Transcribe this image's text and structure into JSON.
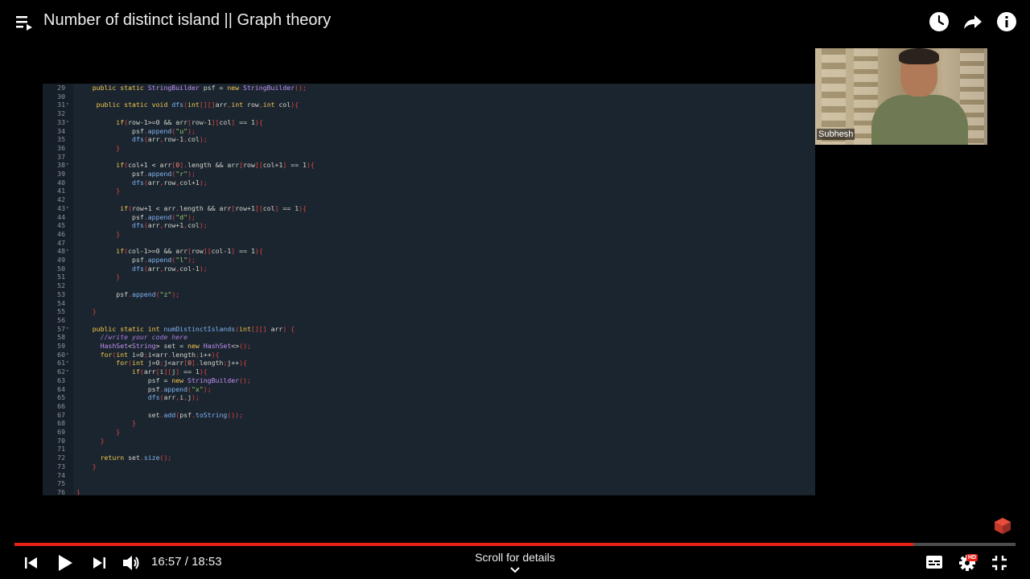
{
  "video": {
    "title": "Number of distinct island || Graph theory",
    "presenter_name": "Subhesh",
    "current_time": "16:57",
    "separator": " / ",
    "duration": "18:53",
    "progress_fraction": 0.898,
    "scroll_hint": "Scroll for details",
    "hd_badge": "HD"
  },
  "icons": {
    "playlist": "playlist-icon",
    "watch_later": "clock-icon",
    "share": "share-icon",
    "info": "info-icon",
    "prev": "previous-icon",
    "play": "play-icon",
    "next": "next-icon",
    "volume": "volume-icon",
    "captions": "captions-icon",
    "settings": "gear-icon",
    "fullscreen_exit": "exit-fullscreen-icon"
  },
  "colors": {
    "progress": "#e62117",
    "editor_bg": "#1b2530"
  },
  "code_lines": [
    {
      "n": "29",
      "fold": false,
      "parts": [
        [
          "",
          "    "
        ],
        [
          "kw",
          "public static "
        ],
        [
          "ty",
          "StringBuilder "
        ],
        [
          "",
          "psf = "
        ],
        [
          "kw",
          "new "
        ],
        [
          "ty",
          "StringBuilder"
        ],
        [
          "pn",
          "();"
        ]
      ]
    },
    {
      "n": "30",
      "fold": false,
      "parts": []
    },
    {
      "n": "31",
      "fold": true,
      "parts": [
        [
          "",
          "     "
        ],
        [
          "kw",
          "public static void "
        ],
        [
          "fn",
          "dfs"
        ],
        [
          "pn",
          "("
        ],
        [
          "kw",
          "int"
        ],
        [
          "pn",
          "[][]"
        ],
        [
          "",
          "arr"
        ],
        [
          "pn",
          ","
        ],
        [
          "kw",
          "int "
        ],
        [
          "",
          "row"
        ],
        [
          "pn",
          ","
        ],
        [
          "kw",
          "int "
        ],
        [
          "",
          "col"
        ],
        [
          "pn",
          "){"
        ]
      ]
    },
    {
      "n": "32",
      "fold": false,
      "parts": []
    },
    {
      "n": "33",
      "fold": true,
      "parts": [
        [
          "",
          "          "
        ],
        [
          "kw",
          "if"
        ],
        [
          "pn",
          "("
        ],
        [
          "",
          "row-1>=0 && arr"
        ],
        [
          "pn",
          "["
        ],
        [
          "",
          "row-1"
        ],
        [
          "pn",
          "]["
        ],
        [
          "",
          "col"
        ],
        [
          "pn",
          "]"
        ],
        [
          "",
          " == 1"
        ],
        [
          "pn",
          "){"
        ]
      ]
    },
    {
      "n": "34",
      "fold": false,
      "parts": [
        [
          "",
          "              psf"
        ],
        [
          "pn",
          "."
        ],
        [
          "fn",
          "append"
        ],
        [
          "pn",
          "("
        ],
        [
          "str",
          "\"u\""
        ],
        [
          "pn",
          ");"
        ]
      ]
    },
    {
      "n": "35",
      "fold": false,
      "parts": [
        [
          "",
          "              "
        ],
        [
          "fn",
          "dfs"
        ],
        [
          "pn",
          "("
        ],
        [
          "",
          "arr"
        ],
        [
          "pn",
          ","
        ],
        [
          "",
          "row-1"
        ],
        [
          "pn",
          ","
        ],
        [
          "",
          "col"
        ],
        [
          "pn",
          ");"
        ]
      ]
    },
    {
      "n": "36",
      "fold": false,
      "parts": [
        [
          "pn",
          "          }"
        ]
      ]
    },
    {
      "n": "37",
      "fold": false,
      "parts": []
    },
    {
      "n": "38",
      "fold": true,
      "parts": [
        [
          "",
          "          "
        ],
        [
          "kw",
          "if"
        ],
        [
          "pn",
          "("
        ],
        [
          "",
          "col+1 < arr"
        ],
        [
          "pn",
          "["
        ],
        [
          "nm",
          "0"
        ],
        [
          "pn",
          "]."
        ],
        [
          "",
          "length && arr"
        ],
        [
          "pn",
          "["
        ],
        [
          "",
          "row"
        ],
        [
          "pn",
          "]["
        ],
        [
          "",
          "col+1"
        ],
        [
          "pn",
          "]"
        ],
        [
          "",
          " == 1"
        ],
        [
          "pn",
          "){"
        ]
      ]
    },
    {
      "n": "39",
      "fold": false,
      "parts": [
        [
          "",
          "              psf"
        ],
        [
          "pn",
          "."
        ],
        [
          "fn",
          "append"
        ],
        [
          "pn",
          "("
        ],
        [
          "str",
          "\"r\""
        ],
        [
          "pn",
          ");"
        ]
      ]
    },
    {
      "n": "40",
      "fold": false,
      "parts": [
        [
          "",
          "              "
        ],
        [
          "fn",
          "dfs"
        ],
        [
          "pn",
          "("
        ],
        [
          "",
          "arr"
        ],
        [
          "pn",
          ","
        ],
        [
          "",
          "row"
        ],
        [
          "pn",
          ","
        ],
        [
          "",
          "col+1"
        ],
        [
          "pn",
          ");"
        ]
      ]
    },
    {
      "n": "41",
      "fold": false,
      "parts": [
        [
          "pn",
          "          }"
        ]
      ]
    },
    {
      "n": "42",
      "fold": false,
      "parts": []
    },
    {
      "n": "43",
      "fold": true,
      "parts": [
        [
          "",
          "           "
        ],
        [
          "kw",
          "if"
        ],
        [
          "pn",
          "("
        ],
        [
          "",
          "row+1 < arr"
        ],
        [
          "pn",
          "."
        ],
        [
          "",
          "length && arr"
        ],
        [
          "pn",
          "["
        ],
        [
          "",
          "row+1"
        ],
        [
          "pn",
          "]["
        ],
        [
          "",
          "col"
        ],
        [
          "pn",
          "]"
        ],
        [
          "",
          " == 1"
        ],
        [
          "pn",
          "){"
        ]
      ]
    },
    {
      "n": "44",
      "fold": false,
      "parts": [
        [
          "",
          "              psf"
        ],
        [
          "pn",
          "."
        ],
        [
          "fn",
          "append"
        ],
        [
          "pn",
          "("
        ],
        [
          "str",
          "\"d\""
        ],
        [
          "pn",
          ");"
        ]
      ]
    },
    {
      "n": "45",
      "fold": false,
      "parts": [
        [
          "",
          "              "
        ],
        [
          "fn",
          "dfs"
        ],
        [
          "pn",
          "("
        ],
        [
          "",
          "arr"
        ],
        [
          "pn",
          ","
        ],
        [
          "",
          "row+1"
        ],
        [
          "pn",
          ","
        ],
        [
          "",
          "col"
        ],
        [
          "pn",
          ");"
        ]
      ]
    },
    {
      "n": "46",
      "fold": false,
      "parts": [
        [
          "pn",
          "          }"
        ]
      ]
    },
    {
      "n": "47",
      "fold": false,
      "parts": []
    },
    {
      "n": "48",
      "fold": true,
      "parts": [
        [
          "",
          "          "
        ],
        [
          "kw",
          "if"
        ],
        [
          "pn",
          "("
        ],
        [
          "",
          "col-1>=0 && arr"
        ],
        [
          "pn",
          "["
        ],
        [
          "",
          "row"
        ],
        [
          "pn",
          "]["
        ],
        [
          "",
          "col-1"
        ],
        [
          "pn",
          "]"
        ],
        [
          "",
          " == 1"
        ],
        [
          "pn",
          "){"
        ]
      ]
    },
    {
      "n": "49",
      "fold": false,
      "parts": [
        [
          "",
          "              psf"
        ],
        [
          "pn",
          "."
        ],
        [
          "fn",
          "append"
        ],
        [
          "pn",
          "("
        ],
        [
          "str",
          "\"l\""
        ],
        [
          "pn",
          ");"
        ]
      ]
    },
    {
      "n": "50",
      "fold": false,
      "parts": [
        [
          "",
          "              "
        ],
        [
          "fn",
          "dfs"
        ],
        [
          "pn",
          "("
        ],
        [
          "",
          "arr"
        ],
        [
          "pn",
          ","
        ],
        [
          "",
          "row"
        ],
        [
          "pn",
          ","
        ],
        [
          "",
          "col-1"
        ],
        [
          "pn",
          ");"
        ]
      ]
    },
    {
      "n": "51",
      "fold": false,
      "parts": [
        [
          "pn",
          "          }"
        ]
      ]
    },
    {
      "n": "52",
      "fold": false,
      "parts": []
    },
    {
      "n": "53",
      "fold": false,
      "parts": [
        [
          "",
          "          psf"
        ],
        [
          "pn",
          "."
        ],
        [
          "fn",
          "append"
        ],
        [
          "pn",
          "("
        ],
        [
          "str",
          "\"z\""
        ],
        [
          "pn",
          ");"
        ]
      ]
    },
    {
      "n": "54",
      "fold": false,
      "parts": []
    },
    {
      "n": "55",
      "fold": false,
      "parts": [
        [
          "pn",
          "    }"
        ]
      ]
    },
    {
      "n": "56",
      "fold": false,
      "parts": []
    },
    {
      "n": "57",
      "fold": true,
      "parts": [
        [
          "",
          "    "
        ],
        [
          "kw",
          "public static int "
        ],
        [
          "fn",
          "numDistinctIslands"
        ],
        [
          "pn",
          "("
        ],
        [
          "kw",
          "int"
        ],
        [
          "pn",
          "[][]"
        ],
        [
          "",
          " arr"
        ],
        [
          "pn",
          ") {"
        ]
      ]
    },
    {
      "n": "58",
      "fold": false,
      "parts": [
        [
          "",
          "      "
        ],
        [
          "cm",
          "//write your code here"
        ]
      ]
    },
    {
      "n": "59",
      "fold": false,
      "parts": [
        [
          "",
          "      "
        ],
        [
          "ty",
          "HashSet"
        ],
        [
          "",
          "<"
        ],
        [
          "ty",
          "String"
        ],
        [
          "",
          "> set = "
        ],
        [
          "kw",
          "new "
        ],
        [
          "ty",
          "HashSet"
        ],
        [
          "",
          "<>"
        ],
        [
          "pn",
          "();"
        ]
      ]
    },
    {
      "n": "60",
      "fold": true,
      "parts": [
        [
          "",
          "      "
        ],
        [
          "kw",
          "for"
        ],
        [
          "pn",
          "("
        ],
        [
          "kw",
          "int "
        ],
        [
          "",
          "i=0"
        ],
        [
          "pn",
          ";"
        ],
        [
          "",
          "i<arr"
        ],
        [
          "pn",
          "."
        ],
        [
          "",
          "length"
        ],
        [
          "pn",
          ";"
        ],
        [
          "",
          "i++"
        ],
        [
          "pn",
          "){"
        ]
      ]
    },
    {
      "n": "61",
      "fold": true,
      "parts": [
        [
          "",
          "          "
        ],
        [
          "kw",
          "for"
        ],
        [
          "pn",
          "("
        ],
        [
          "kw",
          "int "
        ],
        [
          "",
          "j=0"
        ],
        [
          "pn",
          ";"
        ],
        [
          "",
          "j<arr"
        ],
        [
          "pn",
          "["
        ],
        [
          "nm",
          "0"
        ],
        [
          "pn",
          "]."
        ],
        [
          "",
          "length"
        ],
        [
          "pn",
          ";"
        ],
        [
          "",
          "j++"
        ],
        [
          "pn",
          "){"
        ]
      ]
    },
    {
      "n": "62",
      "fold": true,
      "parts": [
        [
          "",
          "              "
        ],
        [
          "kw",
          "if"
        ],
        [
          "pn",
          "("
        ],
        [
          "",
          "arr"
        ],
        [
          "pn",
          "["
        ],
        [
          "",
          "i"
        ],
        [
          "pn",
          "]["
        ],
        [
          "",
          "j"
        ],
        [
          "pn",
          "]"
        ],
        [
          "",
          " == 1"
        ],
        [
          "pn",
          "){"
        ]
      ]
    },
    {
      "n": "63",
      "fold": false,
      "parts": [
        [
          "",
          "                  psf = "
        ],
        [
          "kw",
          "new "
        ],
        [
          "ty",
          "StringBuilder"
        ],
        [
          "pn",
          "();"
        ]
      ]
    },
    {
      "n": "64",
      "fold": false,
      "parts": [
        [
          "",
          "                  psf"
        ],
        [
          "pn",
          "."
        ],
        [
          "fn",
          "append"
        ],
        [
          "pn",
          "("
        ],
        [
          "str",
          "\"x\""
        ],
        [
          "pn",
          ");"
        ]
      ]
    },
    {
      "n": "65",
      "fold": false,
      "parts": [
        [
          "",
          "                  "
        ],
        [
          "fn",
          "dfs"
        ],
        [
          "pn",
          "("
        ],
        [
          "",
          "arr"
        ],
        [
          "pn",
          ","
        ],
        [
          "",
          "i"
        ],
        [
          "pn",
          ","
        ],
        [
          "",
          "j"
        ],
        [
          "pn",
          ");"
        ]
      ]
    },
    {
      "n": "66",
      "fold": false,
      "parts": []
    },
    {
      "n": "67",
      "fold": false,
      "parts": [
        [
          "",
          "                  set"
        ],
        [
          "pn",
          "."
        ],
        [
          "fn",
          "add"
        ],
        [
          "pn",
          "("
        ],
        [
          "",
          "psf"
        ],
        [
          "pn",
          "."
        ],
        [
          "fn",
          "toString"
        ],
        [
          "pn",
          "());"
        ]
      ]
    },
    {
      "n": "68",
      "fold": false,
      "parts": [
        [
          "pn",
          "              }"
        ]
      ]
    },
    {
      "n": "69",
      "fold": false,
      "parts": [
        [
          "pn",
          "          }"
        ]
      ]
    },
    {
      "n": "70",
      "fold": false,
      "parts": [
        [
          "pn",
          "      }"
        ]
      ]
    },
    {
      "n": "71",
      "fold": false,
      "parts": []
    },
    {
      "n": "72",
      "fold": false,
      "parts": [
        [
          "",
          "      "
        ],
        [
          "kw",
          "return "
        ],
        [
          "",
          "set"
        ],
        [
          "pn",
          "."
        ],
        [
          "fn",
          "size"
        ],
        [
          "pn",
          "();"
        ]
      ]
    },
    {
      "n": "73",
      "fold": false,
      "parts": [
        [
          "pn",
          "    }"
        ]
      ]
    },
    {
      "n": "74",
      "fold": false,
      "parts": []
    },
    {
      "n": "75",
      "fold": false,
      "parts": []
    },
    {
      "n": "76",
      "fold": false,
      "parts": [
        [
          "pn",
          "}"
        ]
      ]
    }
  ]
}
